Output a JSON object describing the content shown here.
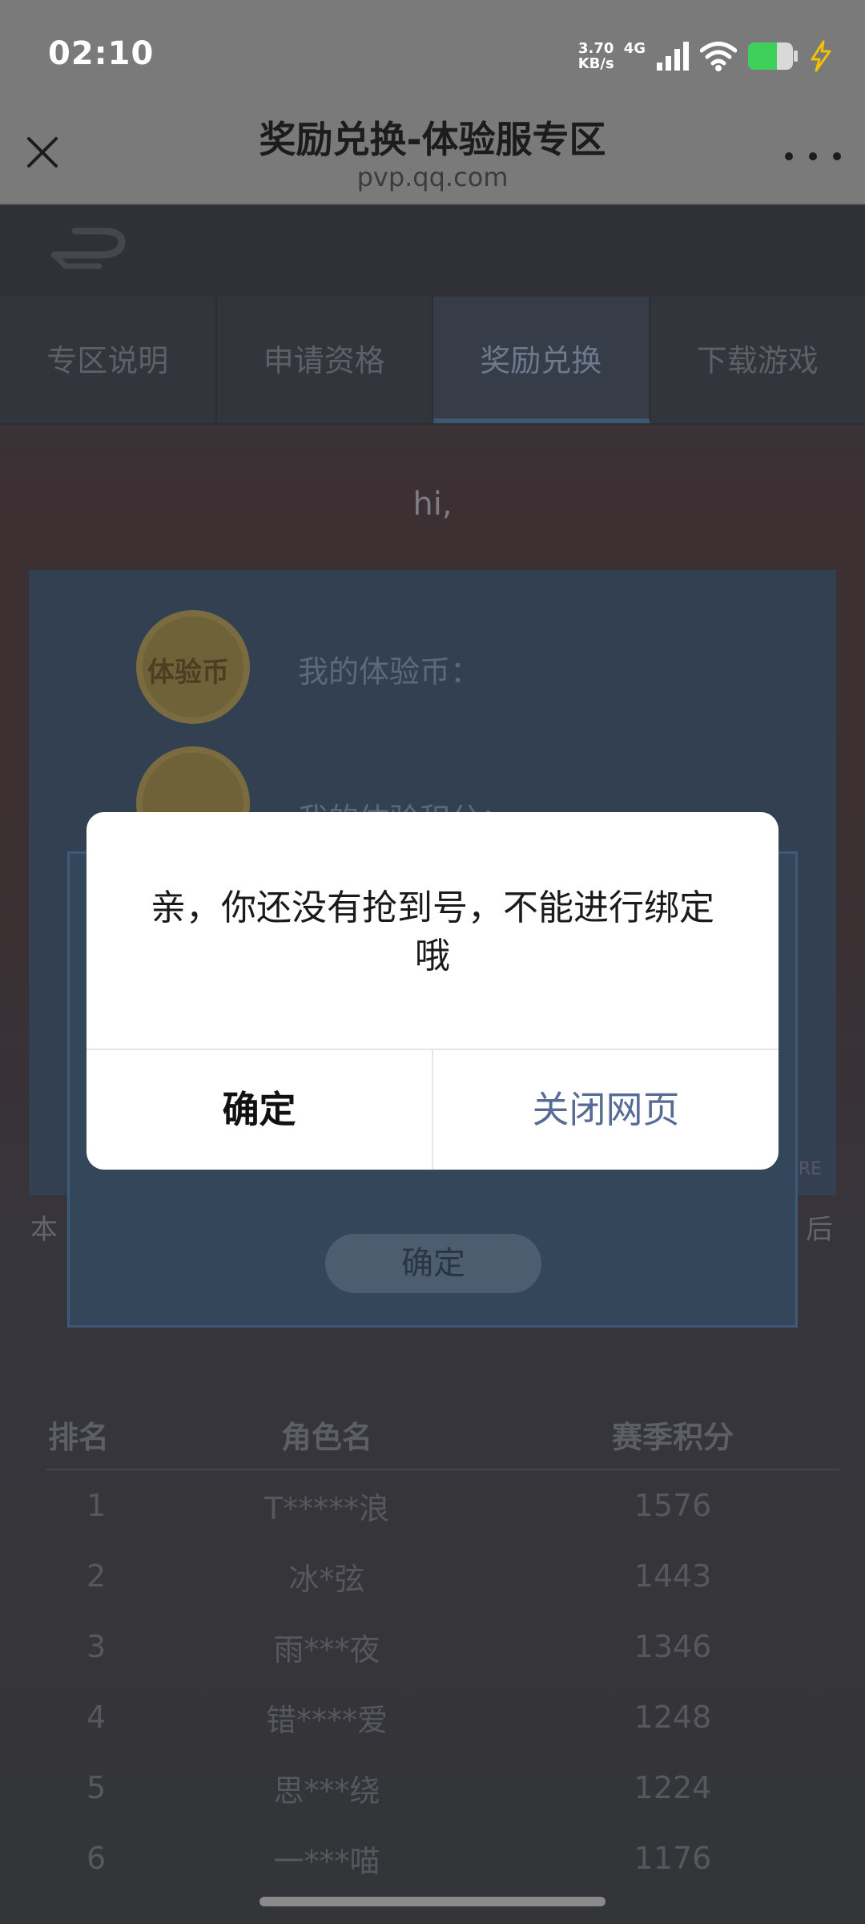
{
  "status_bar": {
    "time": "02:10",
    "net_speed_value": "3.70",
    "net_speed_unit": "KB/s",
    "network_type": "4G",
    "signal_icon": "signal-icon",
    "wifi_icon": "wifi-icon",
    "battery_icon": "battery-icon",
    "charging_icon": "charging-icon",
    "battery_color": "#3fd05c"
  },
  "browser": {
    "title": "奖励兑换-体验服专区",
    "url": "pvp.qq.com",
    "close_icon": "close-icon",
    "more_icon": "more-icon"
  },
  "page": {
    "tabs": [
      {
        "label": "专区说明",
        "active": false
      },
      {
        "label": "申请资格",
        "active": false
      },
      {
        "label": "奖励兑换",
        "active": true
      },
      {
        "label": "下载游戏",
        "active": false
      }
    ],
    "greeting": "hi,",
    "coin_label": "体验币",
    "my_coins_label": "我的体验币：",
    "my_points_label": "我的体验积分：",
    "bind_confirm_label": "确定",
    "side_text_left": "本",
    "side_text_right": "后",
    "side_tag": "RE",
    "ranking": {
      "headers": [
        "排名",
        "角色名",
        "赛季积分"
      ],
      "rows": [
        {
          "rank": "1",
          "name": "T*****浪",
          "score": "1576"
        },
        {
          "rank": "2",
          "name": "冰*弦",
          "score": "1443"
        },
        {
          "rank": "3",
          "name": "雨***夜",
          "score": "1346"
        },
        {
          "rank": "4",
          "name": "错****爱",
          "score": "1248"
        },
        {
          "rank": "5",
          "name": "思***绕",
          "score": "1224"
        },
        {
          "rank": "6",
          "name": "一***喵",
          "score": "1176"
        }
      ]
    }
  },
  "dialog": {
    "message": "亲，你还没有抢到号，不能进行绑定哦",
    "confirm_label": "确定",
    "close_page_label": "关闭网页",
    "link_color": "#576b95"
  }
}
